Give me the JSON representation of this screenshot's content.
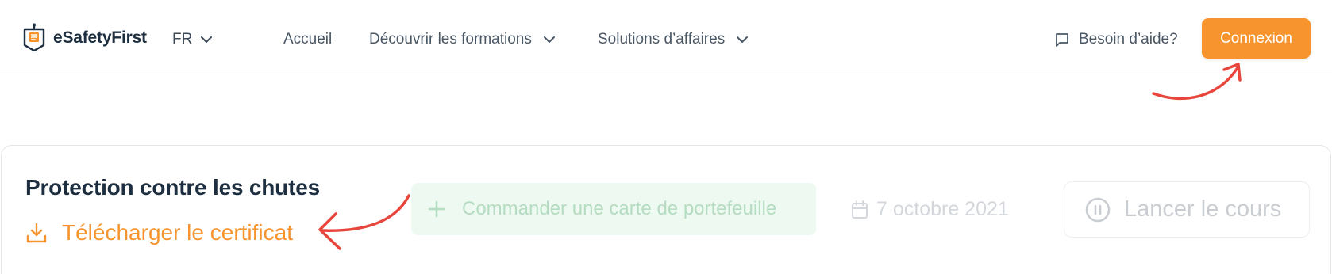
{
  "header": {
    "brand": "eSafetyFirst",
    "language": "FR",
    "nav": [
      {
        "label": "Accueil"
      },
      {
        "label": "Découvrir les formations"
      },
      {
        "label": "Solutions d’affaires"
      }
    ],
    "help_label": "Besoin d’aide?",
    "login_label": "Connexion"
  },
  "course": {
    "title": "Protection contre les chutes",
    "download_label": "Télécharger le certificat",
    "wallet_label": "Commander une carte de portefeuille",
    "date": "7 octobre 2021",
    "launch_label": "Lancer le cours"
  },
  "colors": {
    "accent": "#f7942d",
    "annotation": "#e8453c",
    "wallet_bg": "#eefaf1",
    "text_dark": "#1c2e3f"
  },
  "icons": [
    "shield-logo-icon",
    "chevron-down-icon",
    "chat-bubble-icon",
    "download-icon",
    "plus-icon",
    "calendar-icon",
    "pause-circle-icon"
  ]
}
